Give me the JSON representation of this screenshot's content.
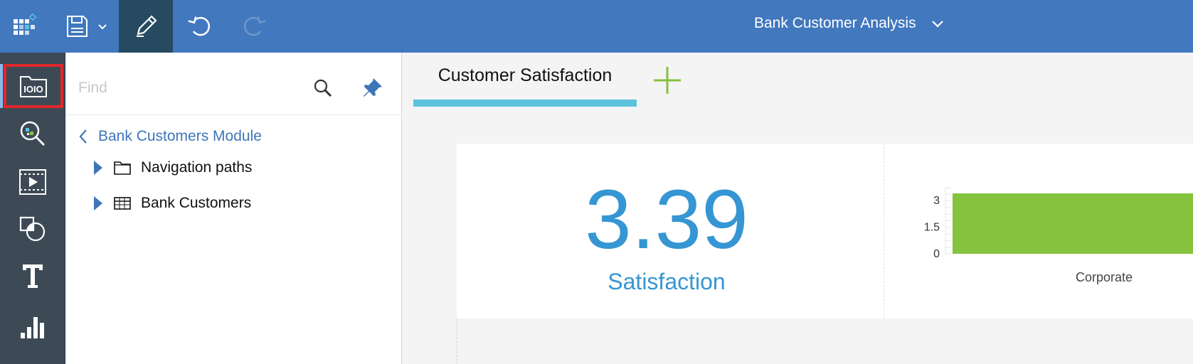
{
  "toolbar": {
    "report_title": "Bank Customer Analysis"
  },
  "panel": {
    "find_placeholder": "Find",
    "module_name": "Bank Customers Module",
    "tree": [
      {
        "label": "Navigation paths",
        "icon": "folder-icon"
      },
      {
        "label": "Bank Customers",
        "icon": "table-icon"
      }
    ]
  },
  "tabs": [
    {
      "label": "Customer Satisfaction",
      "active": true
    }
  ],
  "kpi": {
    "value": "3.39",
    "label": "Satisfaction"
  },
  "colors": {
    "topbar": "#4178be",
    "rail": "#3d4a56",
    "accent_blue": "#3596d3",
    "bar_green": "#85c23d",
    "tab_underline": "#5ac2dd",
    "highlight_red": "#e0272b"
  },
  "chart_data": {
    "type": "bar",
    "categories": [
      "Corporate"
    ],
    "values": [
      3.39
    ],
    "yticks": [
      "3",
      "1.5",
      "0"
    ],
    "ylim": [
      0,
      3.39
    ]
  }
}
